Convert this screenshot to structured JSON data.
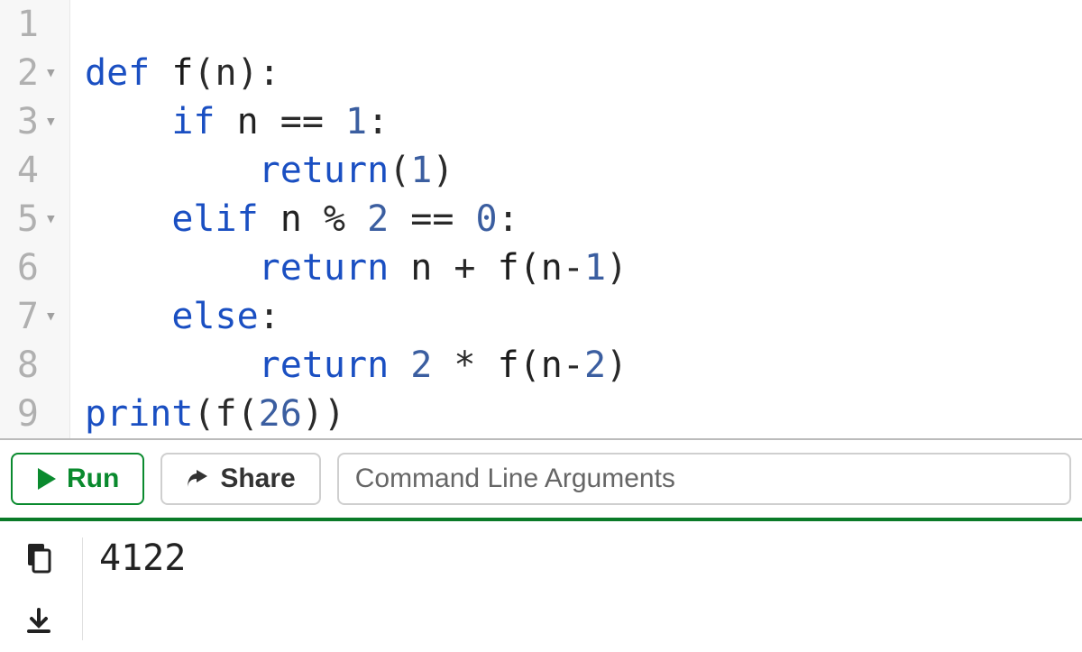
{
  "editor": {
    "lines": [
      {
        "num": "1",
        "fold": false,
        "tokens": []
      },
      {
        "num": "2",
        "fold": true,
        "tokens": [
          {
            "t": "def ",
            "c": "kw"
          },
          {
            "t": "f",
            "c": "fn"
          },
          {
            "t": "(n):",
            "c": "op"
          }
        ]
      },
      {
        "num": "3",
        "fold": true,
        "tokens": [
          {
            "t": "    ",
            "c": "plain"
          },
          {
            "t": "if ",
            "c": "kw"
          },
          {
            "t": "n ",
            "c": "plain"
          },
          {
            "t": "== ",
            "c": "op"
          },
          {
            "t": "1",
            "c": "num"
          },
          {
            "t": ":",
            "c": "op"
          }
        ]
      },
      {
        "num": "4",
        "fold": false,
        "tokens": [
          {
            "t": "        ",
            "c": "plain"
          },
          {
            "t": "return",
            "c": "kw"
          },
          {
            "t": "(",
            "c": "op"
          },
          {
            "t": "1",
            "c": "num"
          },
          {
            "t": ")",
            "c": "op"
          }
        ]
      },
      {
        "num": "5",
        "fold": true,
        "tokens": [
          {
            "t": "    ",
            "c": "plain"
          },
          {
            "t": "elif ",
            "c": "kw"
          },
          {
            "t": "n ",
            "c": "plain"
          },
          {
            "t": "% ",
            "c": "op"
          },
          {
            "t": "2",
            "c": "num"
          },
          {
            "t": " == ",
            "c": "op"
          },
          {
            "t": "0",
            "c": "num"
          },
          {
            "t": ":",
            "c": "op"
          }
        ]
      },
      {
        "num": "6",
        "fold": false,
        "tokens": [
          {
            "t": "        ",
            "c": "plain"
          },
          {
            "t": "return ",
            "c": "kw"
          },
          {
            "t": "n ",
            "c": "plain"
          },
          {
            "t": "+ ",
            "c": "op"
          },
          {
            "t": "f",
            "c": "fn"
          },
          {
            "t": "(n",
            "c": "plain"
          },
          {
            "t": "-",
            "c": "op"
          },
          {
            "t": "1",
            "c": "num"
          },
          {
            "t": ")",
            "c": "op"
          }
        ]
      },
      {
        "num": "7",
        "fold": true,
        "tokens": [
          {
            "t": "    ",
            "c": "plain"
          },
          {
            "t": "else",
            "c": "kw"
          },
          {
            "t": ":",
            "c": "op"
          }
        ]
      },
      {
        "num": "8",
        "fold": false,
        "tokens": [
          {
            "t": "        ",
            "c": "plain"
          },
          {
            "t": "return ",
            "c": "kw"
          },
          {
            "t": "2",
            "c": "num"
          },
          {
            "t": " * ",
            "c": "op"
          },
          {
            "t": "f",
            "c": "fn"
          },
          {
            "t": "(n",
            "c": "plain"
          },
          {
            "t": "-",
            "c": "op"
          },
          {
            "t": "2",
            "c": "num"
          },
          {
            "t": ")",
            "c": "op"
          }
        ]
      },
      {
        "num": "9",
        "fold": false,
        "tokens": [
          {
            "t": "print",
            "c": "kw"
          },
          {
            "t": "(f(",
            "c": "op"
          },
          {
            "t": "26",
            "c": "num"
          },
          {
            "t": "))",
            "c": "op"
          }
        ]
      }
    ]
  },
  "toolbar": {
    "run_label": "Run",
    "share_label": "Share",
    "cmd_placeholder": "Command Line Arguments"
  },
  "output": {
    "text": "4122"
  }
}
